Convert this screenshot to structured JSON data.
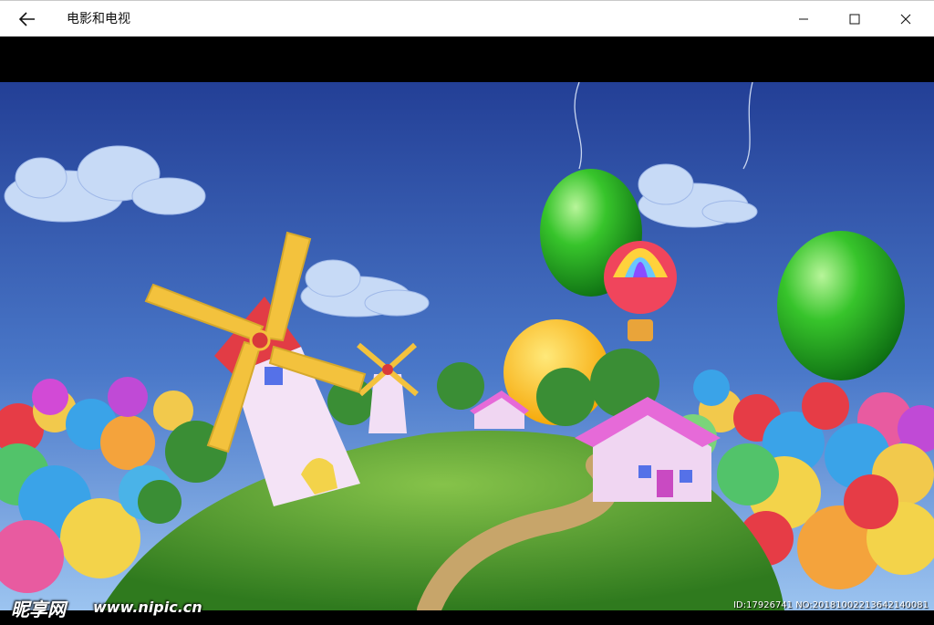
{
  "window": {
    "title": "电影和电视",
    "controls": {
      "back": "back-arrow-icon",
      "minimize": "minimize-icon",
      "maximize": "maximize-icon",
      "close": "close-icon"
    }
  },
  "video": {
    "scene": "cartoon-windmill-balloons-frame",
    "watermark_logo": "昵享网",
    "watermark_url": "www.nipic.cn",
    "watermark_id": "ID:17926741 NO:20181002213642140081"
  },
  "colors": {
    "titlebar_bg": "#ffffff",
    "letterbox": "#000000",
    "sky_top": "#2c56a8",
    "grass": "#4e9a2a"
  }
}
